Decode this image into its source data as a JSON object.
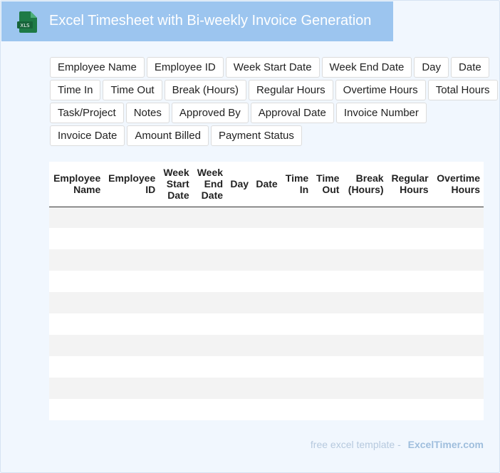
{
  "header": {
    "icon_label": "XLS",
    "title": "Excel Timesheet with Bi-weekly Invoice Generation",
    "colors": {
      "banner": "#9cc5ef",
      "icon": "#1e7a46"
    }
  },
  "chips": [
    "Employee Name",
    "Employee ID",
    "Week Start Date",
    "Week End Date",
    "Day",
    "Date",
    "Time In",
    "Time Out",
    "Break (Hours)",
    "Regular Hours",
    "Overtime Hours",
    "Total Hours",
    "Task/Project",
    "Notes",
    "Approved By",
    "Approval Date",
    "Invoice Number",
    "Invoice Date",
    "Amount Billed",
    "Payment Status"
  ],
  "table": {
    "columns": [
      {
        "lines": [
          "Employee",
          "Name"
        ]
      },
      {
        "lines": [
          "Employee",
          "ID"
        ]
      },
      {
        "lines": [
          "Week",
          "Start",
          "Date"
        ]
      },
      {
        "lines": [
          "Week",
          "End",
          "Date"
        ]
      },
      {
        "lines": [
          "Day"
        ]
      },
      {
        "lines": [
          "Date"
        ]
      },
      {
        "lines": [
          "Time",
          "In"
        ]
      },
      {
        "lines": [
          "Time",
          "Out"
        ]
      },
      {
        "lines": [
          "Break",
          "(Hours)"
        ]
      },
      {
        "lines": [
          "Regular",
          "Hours"
        ]
      },
      {
        "lines": [
          "Overtime",
          "Hours"
        ]
      }
    ],
    "row_count": 10
  },
  "footer": {
    "text": "free excel template -",
    "brand": "ExcelTimer.com"
  }
}
